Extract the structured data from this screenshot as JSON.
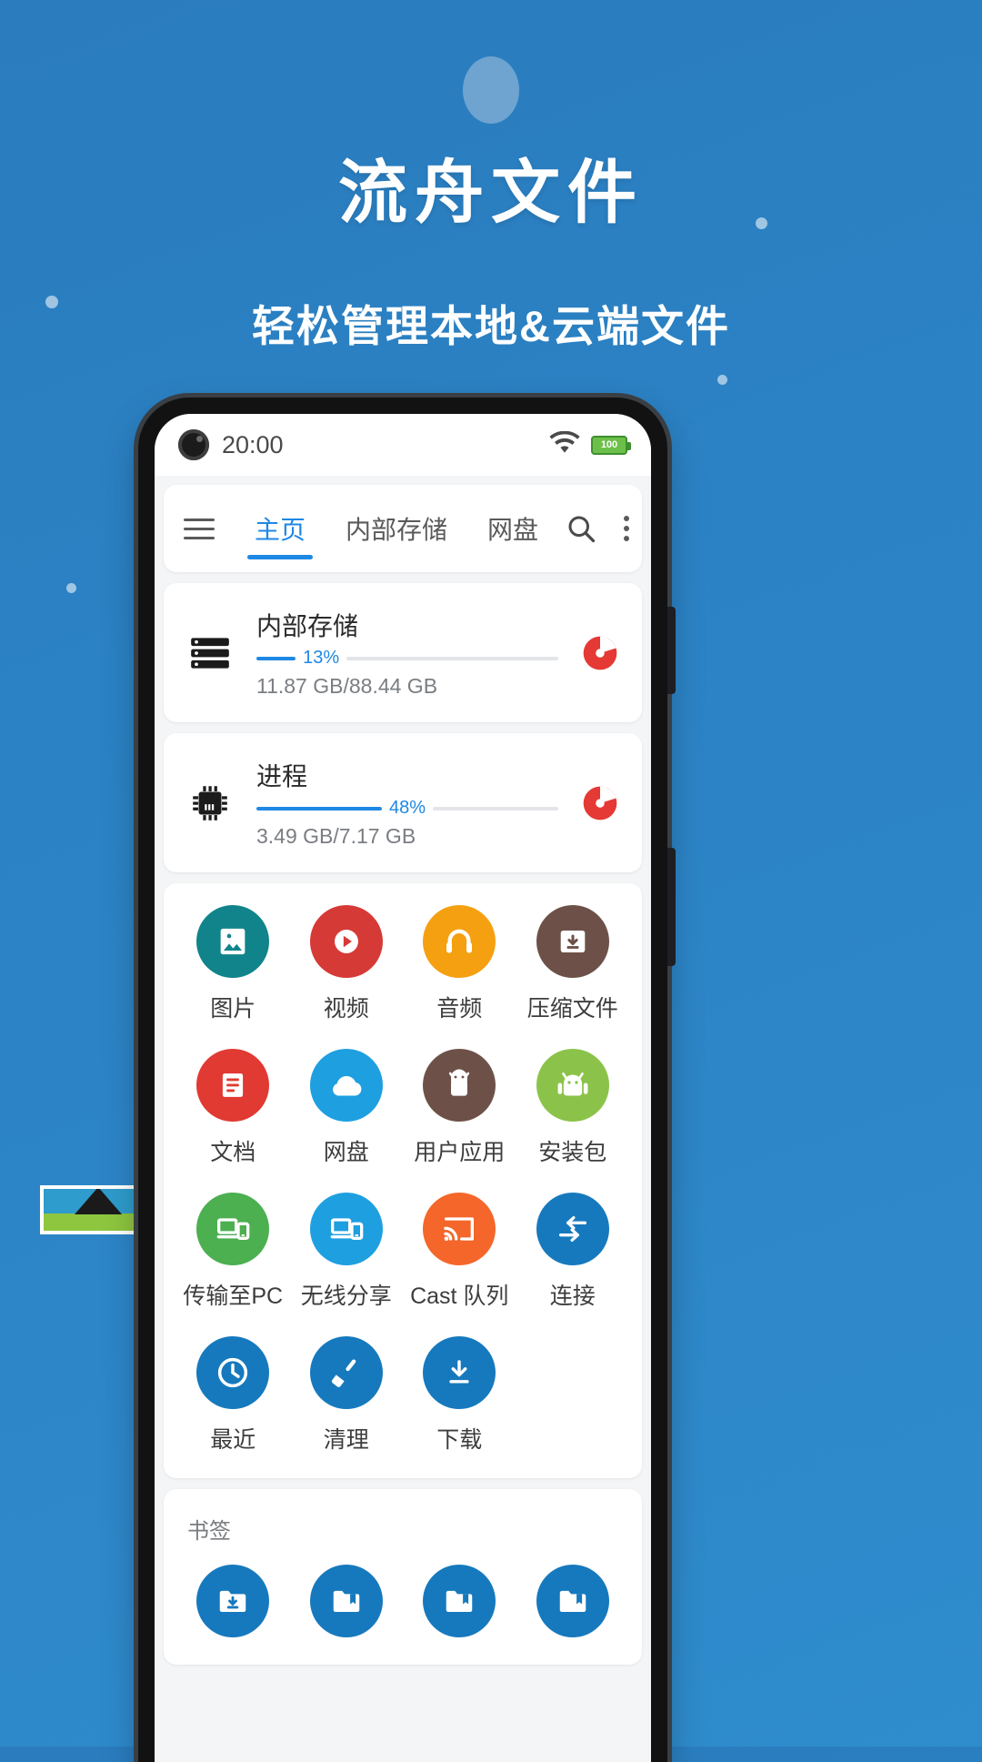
{
  "promo": {
    "title": "流舟文件",
    "subtitle": "轻松管理本地&云端文件"
  },
  "colors": {
    "background_blue": "#2b82c4",
    "accent_blue": "#1e88e5",
    "pie_red": "#e53935",
    "tile_teal": "#10848a",
    "tile_red": "#d63a36",
    "tile_orange": "#f5a011",
    "tile_brown": "#6d5148",
    "tile_green_app": "#8bc34a",
    "tile_green_pc": "#4caf50",
    "tile_cyan": "#1e9fe0",
    "tile_cast_orange": "#f4662a",
    "tile_blue": "#1679bd"
  },
  "statusbar": {
    "time": "20:00",
    "wifi_icon": "wifi-icon",
    "battery_level": "100"
  },
  "tabbar": {
    "menu_icon": "hamburger-menu-icon",
    "search_icon": "search-icon",
    "overflow_icon": "more-vertical-icon",
    "tabs": [
      {
        "label": "主页",
        "active": true
      },
      {
        "label": "内部存储",
        "active": false
      },
      {
        "label": "网盘",
        "active": false
      }
    ]
  },
  "storage_cards": [
    {
      "name": "内部存储",
      "icon": "server-storage-icon",
      "percent_label": "13%",
      "percent": 13,
      "sizes": "11.87 GB/88.44 GB",
      "chart_icon": "pie-chart-icon"
    },
    {
      "name": "进程",
      "icon": "cpu-chip-icon",
      "percent_label": "48%",
      "percent": 48,
      "sizes": "3.49 GB/7.17 GB",
      "chart_icon": "pie-chart-icon"
    }
  ],
  "shortcuts": [
    {
      "label": "图片",
      "icon": "image-icon",
      "color": "#10848a"
    },
    {
      "label": "视频",
      "icon": "play-circle-icon",
      "color": "#d63a36"
    },
    {
      "label": "音频",
      "icon": "headphones-icon",
      "color": "#f5a011"
    },
    {
      "label": "压缩文件",
      "icon": "archive-box-icon",
      "color": "#6d5148"
    },
    {
      "label": "文档",
      "icon": "document-icon",
      "color": "#e03a33"
    },
    {
      "label": "网盘",
      "icon": "cloud-icon",
      "color": "#1e9fe0"
    },
    {
      "label": "用户应用",
      "icon": "android-robot-icon",
      "color": "#6d5148"
    },
    {
      "label": "安装包",
      "icon": "android-apk-icon",
      "color": "#8bc34a"
    },
    {
      "label": "传输至PC",
      "icon": "send-to-pc-icon",
      "color": "#4caf50"
    },
    {
      "label": "无线分享",
      "icon": "wireless-share-icon",
      "color": "#1e9fe0"
    },
    {
      "label": "Cast 队列",
      "icon": "cast-icon",
      "color": "#f4662a"
    },
    {
      "label": "连接",
      "icon": "connect-arrows-icon",
      "color": "#1679bd"
    },
    {
      "label": "最近",
      "icon": "clock-icon",
      "color": "#1679bd"
    },
    {
      "label": "清理",
      "icon": "broom-clean-icon",
      "color": "#1679bd"
    },
    {
      "label": "下载",
      "icon": "download-icon",
      "color": "#1679bd"
    }
  ],
  "bookmarks": {
    "title": "书签",
    "items": [
      {
        "icon": "folder-download-icon"
      },
      {
        "icon": "folder-bookmark-icon"
      },
      {
        "icon": "folder-bookmark-icon"
      },
      {
        "icon": "folder-bookmark-icon"
      }
    ]
  }
}
